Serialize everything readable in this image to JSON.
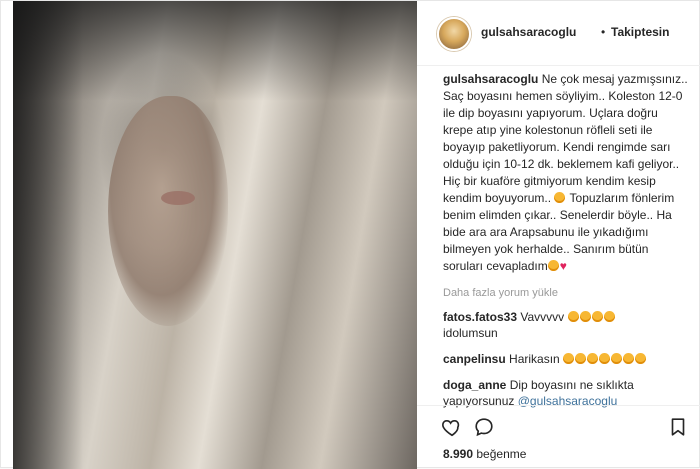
{
  "post": {
    "username": "gulsahsaracoglu",
    "separator": "•",
    "follow_status": "Takiptesin",
    "caption_text": "Ne çok mesaj yazmışsınız.. Saç boyasını hemen söyliyim.. Koleston 12-0 ile dip boyasını yapıyorum. Uçlara doğru krepe atıp yine kolestonun röfleli seti ile boyayıp paketliyorum. Kendi rengimde sarı olduğu için 10-12 dk. beklemem kafi geliyor.. Hiç bir kuaföre gitmiyorum kendim kesip kendim boyuyorum..",
    "caption_text_2": "Topuzlarım fönlerim benim elimden çıkar.. Senelerdir böyle.. Ha bide ara ara Arapsabunu ile yıkadığımı bilmeyen yok herhalde..",
    "caption_text_3": "Sanırım bütün soruları cevapladım",
    "load_more": "Daha fazla yorum yükle",
    "likes_count": "8.990",
    "likes_label": "beğenme"
  },
  "comments": [
    {
      "user": "fatos.fatos33",
      "text": "Vavvvvv",
      "text2": "idolumsun"
    },
    {
      "user": "canpelinsu",
      "text": "Harikasın"
    },
    {
      "user": "doga_anne",
      "text": "Dip boyasını ne sıklıkta yapıyorsunuz",
      "mention": "@gulsahsaracoglu"
    }
  ],
  "icons": {
    "like": "heart-outline-icon",
    "comment": "speech-bubble-icon",
    "save": "bookmark-icon"
  },
  "colors": {
    "heart": "#e0245e",
    "mention": "#3f729b",
    "muted": "#999999"
  }
}
